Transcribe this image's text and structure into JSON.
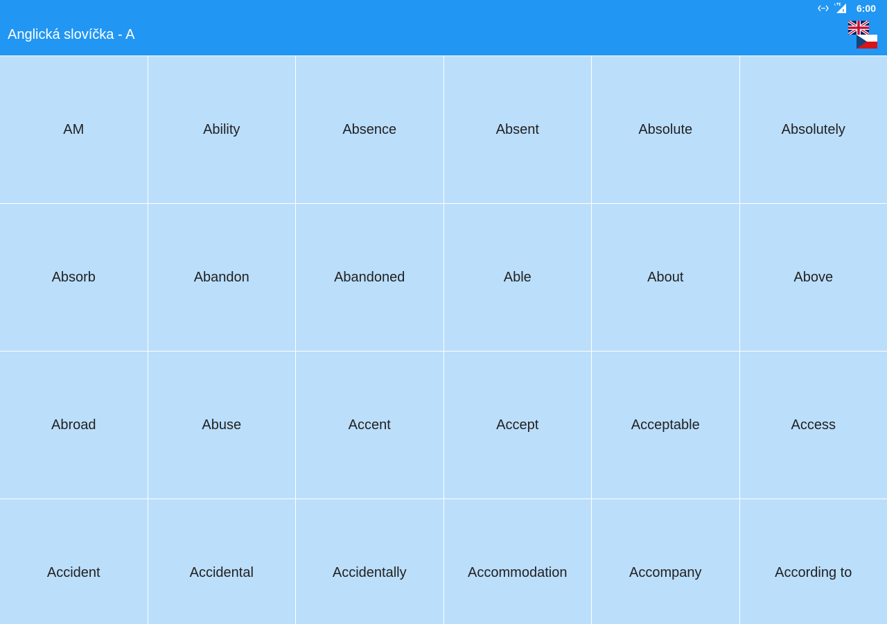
{
  "colors": {
    "appbar": "#2196f3",
    "cell_background": "#bbdefb",
    "divider": "#ffffff",
    "text_dark": "#212121",
    "text_light": "#ffffff"
  },
  "status_bar": {
    "icons": [
      "data-transfer-icon",
      "lte-signal-icon"
    ],
    "time": "6:00"
  },
  "app_bar": {
    "title": "Anglická slovíčka - A",
    "language_toggle": {
      "icons": [
        "uk-flag-icon",
        "czech-flag-icon"
      ]
    }
  },
  "words": [
    "AM",
    "Ability",
    "Absence",
    "Absent",
    "Absolute",
    "Absolutely",
    "Absorb",
    "Abandon",
    "Abandoned",
    "Able",
    "About",
    "Above",
    "Abroad",
    "Abuse",
    "Accent",
    "Accept",
    "Acceptable",
    "Access",
    "Accident",
    "Accidental",
    "Accidentally",
    "Accommodation",
    "Accompany",
    "According to"
  ]
}
